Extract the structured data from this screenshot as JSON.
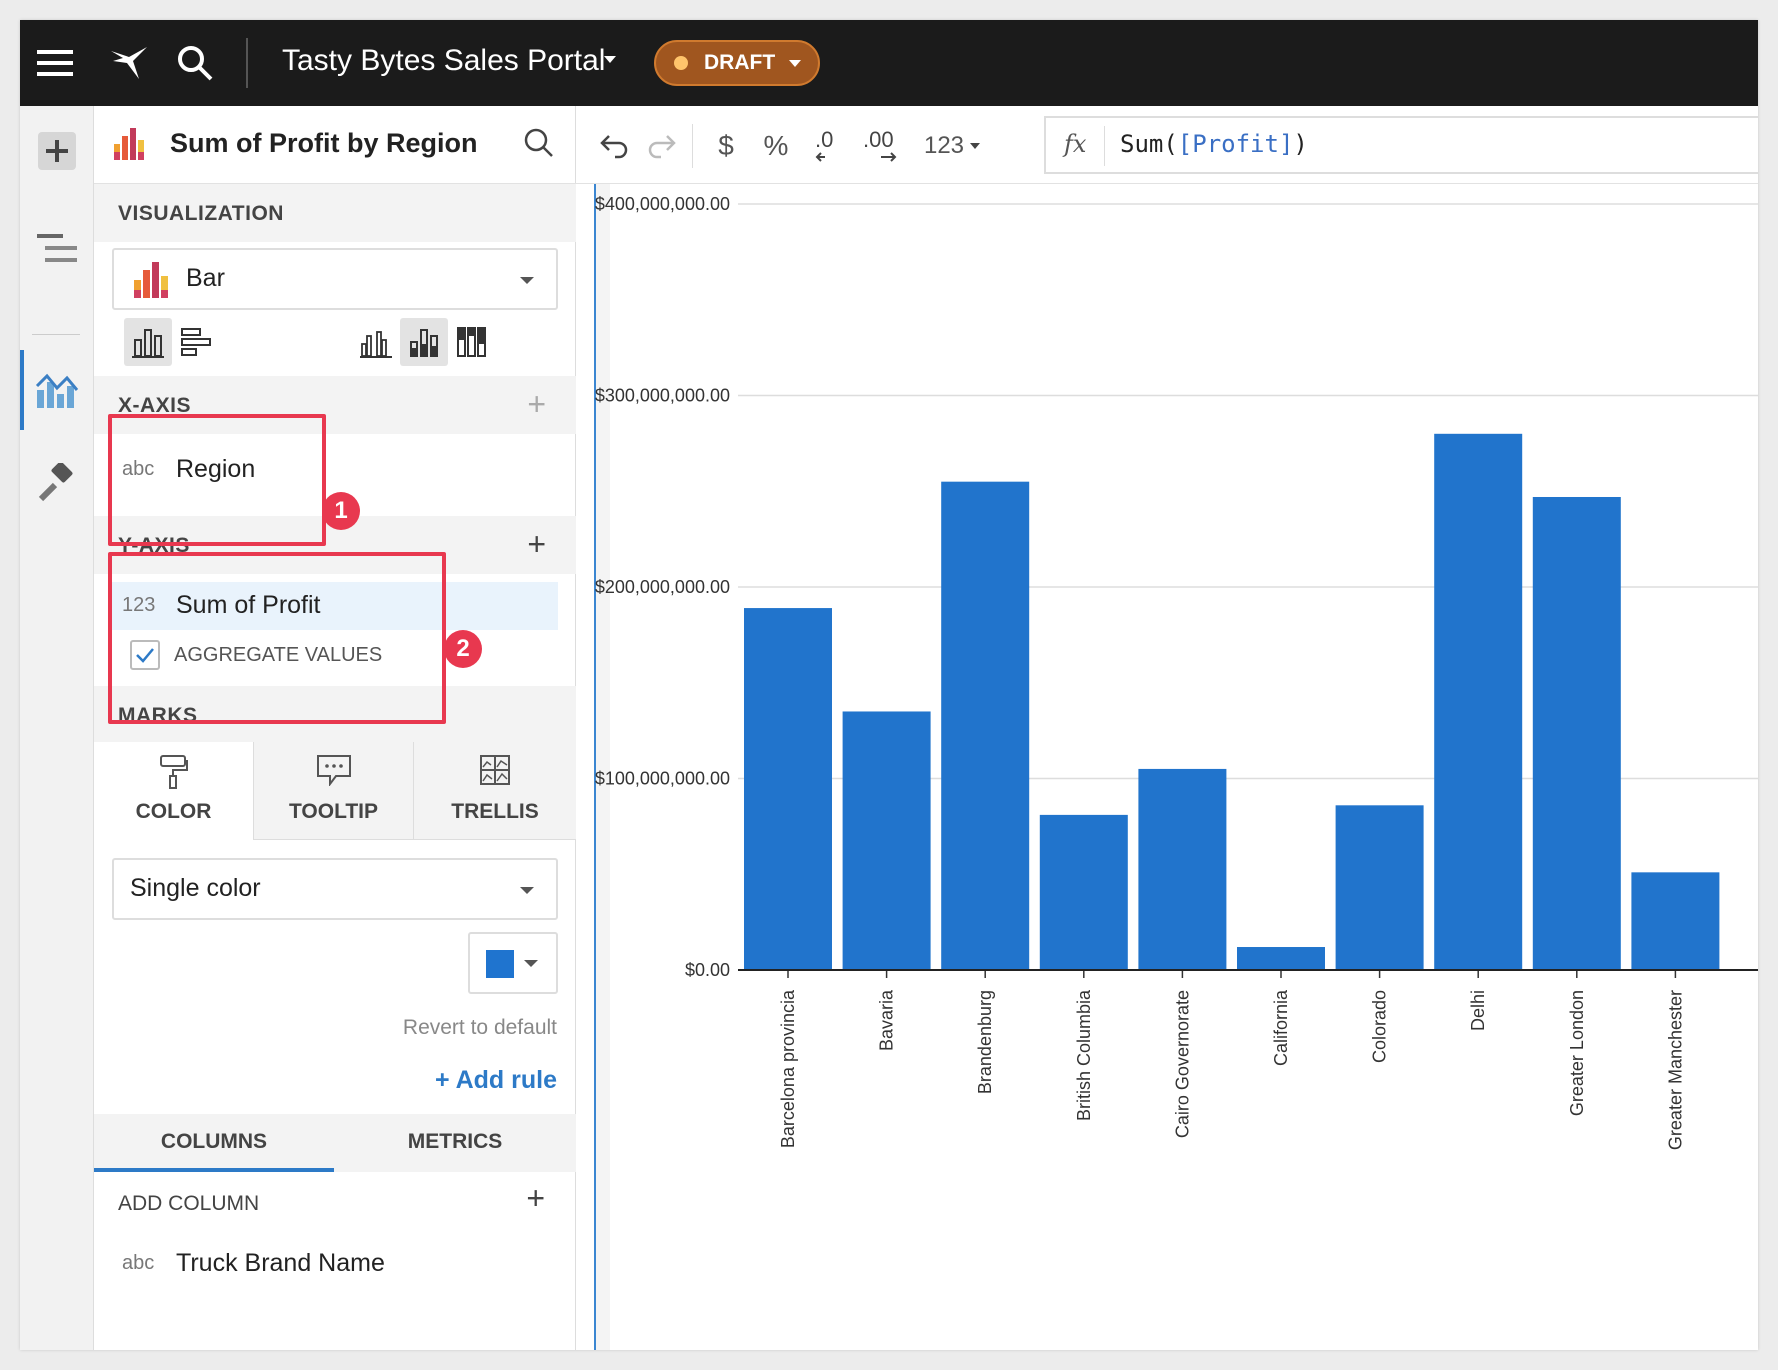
{
  "header": {
    "app_title": "Tasty Bytes Sales Portal",
    "draft_label": "DRAFT",
    "icons": [
      "hamburger-menu-icon",
      "bird-logo-icon",
      "search-icon"
    ]
  },
  "rail": {
    "items": [
      "add-icon",
      "layers-icon",
      "chart-editor-icon",
      "paint-brush-icon"
    ]
  },
  "panel": {
    "title": "Sum of Profit by Region",
    "visualization_label": "VISUALIZATION",
    "viz_type": "Bar",
    "x_axis": {
      "label": "X-AXIS",
      "field_type": "abc",
      "field_name": "Region"
    },
    "y_axis": {
      "label": "Y-AXIS",
      "field_type": "123",
      "field_name": "Sum of Profit",
      "aggregate_label": "AGGREGATE VALUES",
      "aggregate_checked": true
    },
    "marks": {
      "label": "MARKS",
      "tabs": [
        "COLOR",
        "TOOLTIP",
        "TRELLIS"
      ],
      "active_tab": "COLOR",
      "color_mode": "Single color",
      "color_swatch": "#1f74cf",
      "revert_label": "Revert to default",
      "add_rule_label": "+ Add rule"
    },
    "bottom_tabs": [
      "COLUMNS",
      "METRICS"
    ],
    "add_column_label": "ADD COLUMN",
    "columns": [
      {
        "type": "abc",
        "name": "Truck Brand Name"
      }
    ],
    "annotations": [
      "1",
      "2"
    ]
  },
  "toolbar": {
    "tools": [
      "undo-icon",
      "redo-icon",
      "$",
      "%",
      ".0",
      ".00",
      "123"
    ],
    "number_format_label": "123",
    "fx_label": "fx",
    "formula_fn": "Sum(",
    "formula_col": "[Profit]",
    "formula_close": ")"
  },
  "colors": {
    "bar": "#2174cc",
    "accent": "#2d7ac7",
    "annotation": "#e8384f",
    "draft": "#a0561f"
  },
  "chart_data": {
    "type": "bar",
    "categories": [
      "Barcelona provincia",
      "Bavaria",
      "Brandenburg",
      "British Columbia",
      "Cairo Governorate",
      "California",
      "Colorado",
      "Delhi",
      "Greater London",
      "Greater Manchester"
    ],
    "values": [
      189000000,
      135000000,
      255000000,
      81000000,
      105000000,
      12000000,
      86000000,
      280000000,
      247000000,
      51000000
    ],
    "y_ticks": [
      "$0.00",
      "$100,000,000.00",
      "$200,000,000.00",
      "$300,000,000.00",
      "$400,000,000.00"
    ],
    "ylim": [
      0,
      400000000
    ],
    "grid": true
  }
}
